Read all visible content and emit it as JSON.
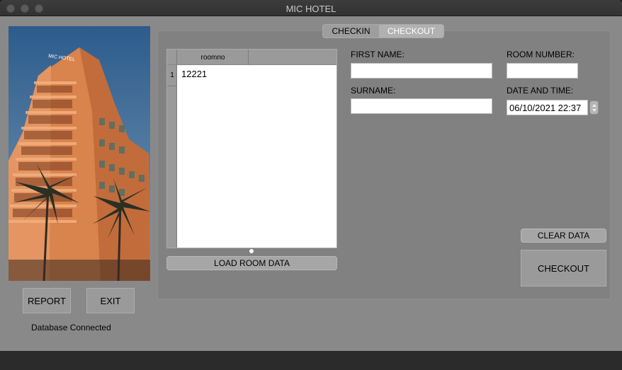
{
  "window": {
    "title": "MIC HOTEL"
  },
  "left": {
    "report_label": "REPORT",
    "exit_label": "EXIT",
    "status": "Database Connected",
    "photo_sign": "MIC HOTEL"
  },
  "tabs": {
    "checkin": "CHECKIN",
    "checkout": "CHECKOUT"
  },
  "table": {
    "columns": [
      "roomno"
    ],
    "rows": [
      {
        "num": "1",
        "roomno": "12221"
      }
    ]
  },
  "buttons": {
    "load_room_data": "LOAD ROOM DATA",
    "clear_data": "CLEAR DATA",
    "checkout": "CHECKOUT"
  },
  "form": {
    "first_name_label": "FIRST NAME:",
    "first_name_value": "",
    "room_number_label": "ROOM NUMBER:",
    "room_number_value": "",
    "surname_label": "SURNAME:",
    "surname_value": "",
    "date_time_label": "DATE AND TIME:",
    "date_time_value": "06/10/2021 22:37"
  },
  "colors": {
    "window_bg": "#898989",
    "panel_bg": "#818181",
    "titlebar": "#363636",
    "tab_active_text": "#ffffff"
  }
}
